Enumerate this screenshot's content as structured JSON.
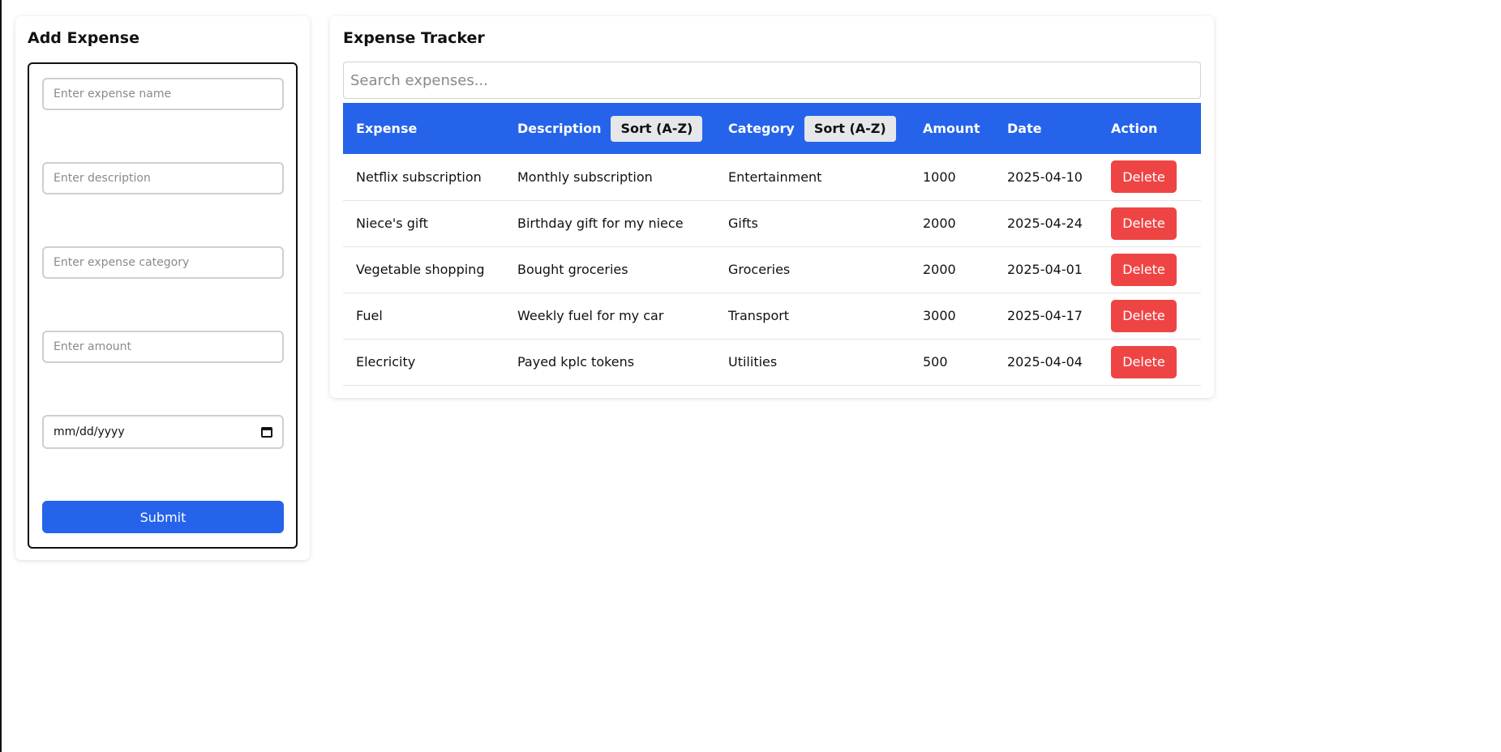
{
  "form": {
    "title": "Add Expense",
    "name_placeholder": "Enter expense name",
    "description_placeholder": "Enter description",
    "category_placeholder": "Enter expense category",
    "amount_placeholder": "Enter amount",
    "date_placeholder": "mm/dd/yyyy",
    "submit_label": "Submit"
  },
  "tracker": {
    "title": "Expense Tracker",
    "search_placeholder": "Search expenses...",
    "headers": {
      "expense": "Expense",
      "description": "Description",
      "category": "Category",
      "amount": "Amount",
      "date": "Date",
      "action": "Action"
    },
    "sort_label": "Sort (A-Z)",
    "delete_label": "Delete",
    "rows": [
      {
        "expense": "Netflix subscription",
        "description": "Monthly subscription",
        "category": "Entertainment",
        "amount": "1000",
        "date": "2025-04-10"
      },
      {
        "expense": "Niece's gift",
        "description": "Birthday gift for my niece",
        "category": "Gifts",
        "amount": "2000",
        "date": "2025-04-24"
      },
      {
        "expense": "Vegetable shopping",
        "description": "Bought groceries",
        "category": "Groceries",
        "amount": "2000",
        "date": "2025-04-01"
      },
      {
        "expense": "Fuel",
        "description": "Weekly fuel for my car",
        "category": "Transport",
        "amount": "3000",
        "date": "2025-04-17"
      },
      {
        "expense": "Elecricity",
        "description": "Payed kplc tokens",
        "category": "Utilities",
        "amount": "500",
        "date": "2025-04-04"
      }
    ]
  },
  "colors": {
    "primary": "#2563eb",
    "danger": "#ef4444",
    "sort_button_bg": "#e5e7eb"
  },
  "icons": {
    "date_picker": "calendar-icon"
  }
}
